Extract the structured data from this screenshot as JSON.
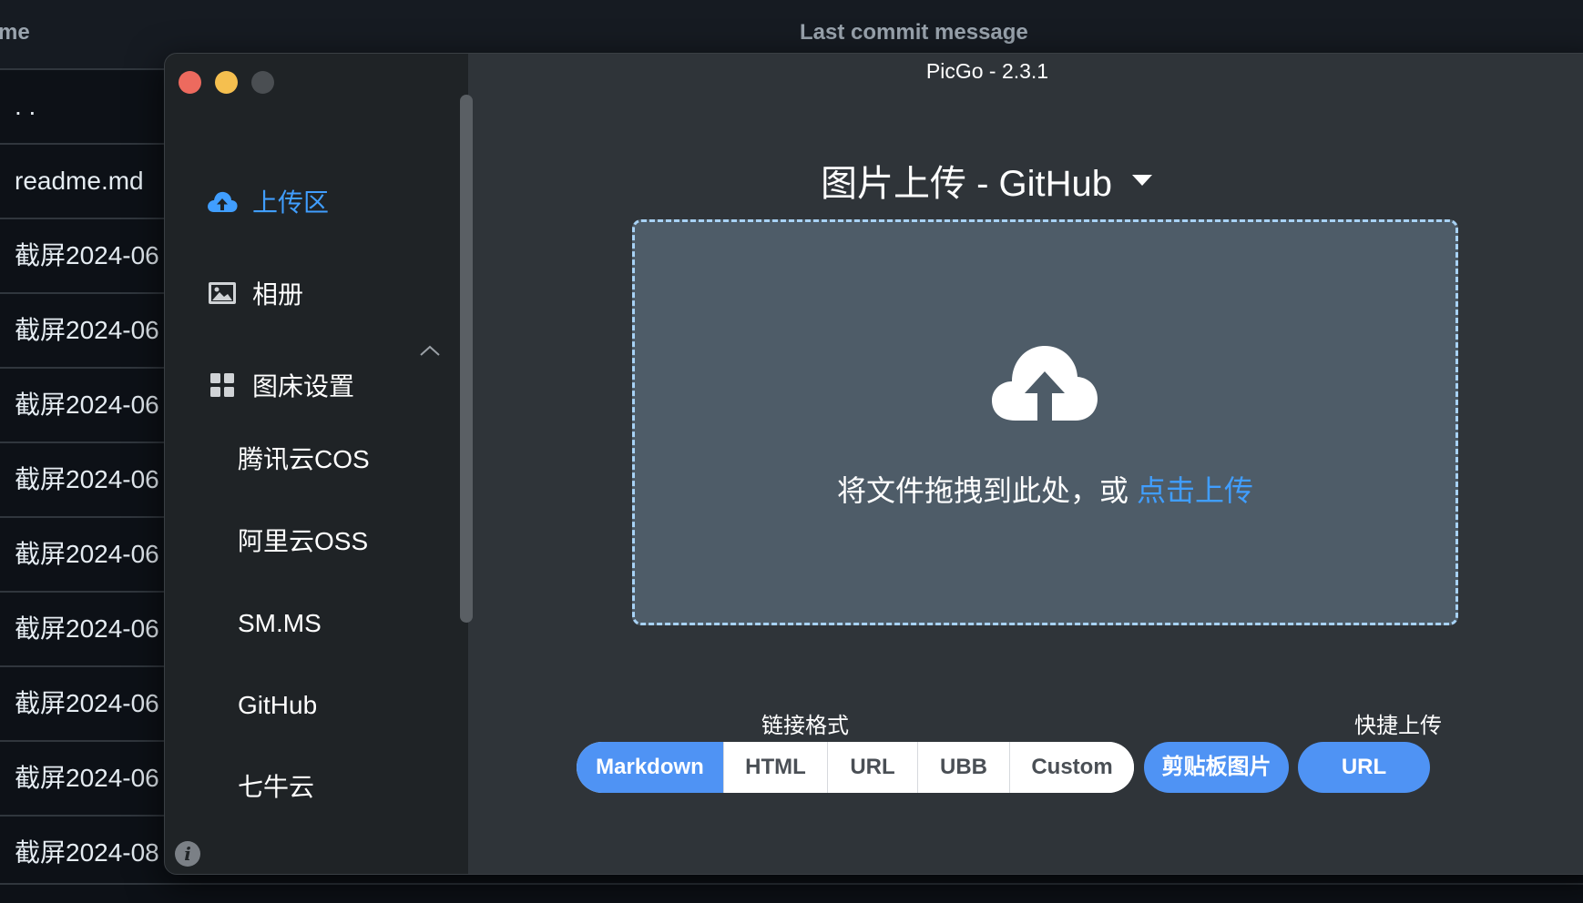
{
  "background": {
    "header": {
      "name_col": "me",
      "commit_col": "Last commit message"
    },
    "rows": [
      ". .",
      "readme.md",
      "截屏2024-06",
      "截屏2024-06",
      "截屏2024-06",
      "截屏2024-06",
      "截屏2024-06",
      "截屏2024-06",
      "截屏2024-06",
      "截屏2024-06",
      "截屏2024-08"
    ]
  },
  "window": {
    "title": "PicGo - 2.3.1"
  },
  "sidebar": {
    "items": [
      {
        "label": "上传区",
        "icon": "cloud-upload-icon",
        "active": true
      },
      {
        "label": "相册",
        "icon": "image-icon"
      },
      {
        "label": "图床设置",
        "icon": "grid-icon",
        "expanded": true
      }
    ],
    "sub_items": [
      "腾讯云COS",
      "阿里云OSS",
      "SM.MS",
      "GitHub",
      "七牛云"
    ],
    "info_glyph": "i"
  },
  "main": {
    "title": "图片上传 - GitHub",
    "drop_text": "将文件拖拽到此处，或",
    "drop_link": "点击上传",
    "link_format_label": "链接格式",
    "link_formats": [
      "Markdown",
      "HTML",
      "URL",
      "UBB",
      "Custom"
    ],
    "selected_format": "Markdown",
    "quick_upload_label": "快捷上传",
    "quick_buttons": [
      "剪贴板图片",
      "URL"
    ]
  },
  "colors": {
    "accent": "#409eff",
    "button": "#4f93f4",
    "dropzone_border": "#a8d2f5"
  }
}
